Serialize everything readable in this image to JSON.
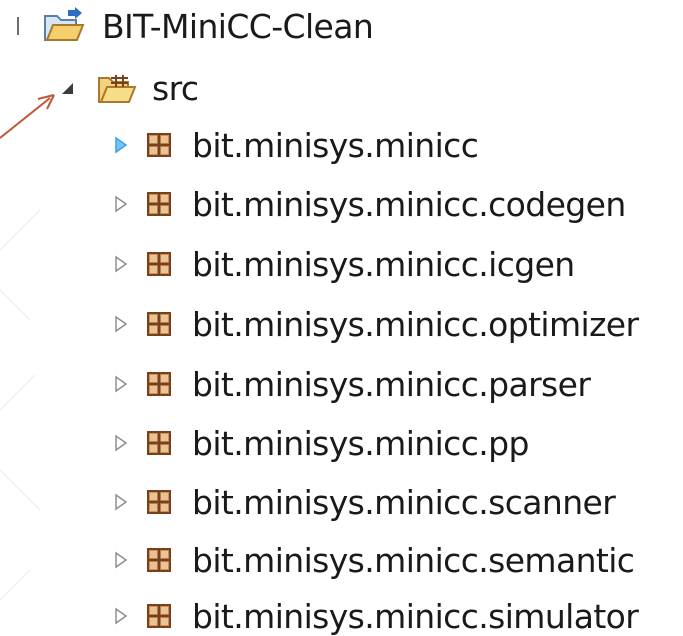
{
  "tree": {
    "project": {
      "label": "BIT-MiniCC-Clean",
      "icon": "project-folder-icon",
      "expanded": true
    },
    "source_folder": {
      "label": "src",
      "icon": "source-folder-icon",
      "expanded": true
    },
    "packages": [
      {
        "label": "bit.minisys.minicc",
        "icon": "package-icon",
        "expanded": false,
        "hovered": true
      },
      {
        "label": "bit.minisys.minicc.codegen",
        "icon": "package-icon",
        "expanded": false
      },
      {
        "label": "bit.minisys.minicc.icgen",
        "icon": "package-icon",
        "expanded": false
      },
      {
        "label": "bit.minisys.minicc.optimizer",
        "icon": "package-icon",
        "expanded": false
      },
      {
        "label": "bit.minisys.minicc.parser",
        "icon": "package-icon",
        "expanded": false
      },
      {
        "label": "bit.minisys.minicc.pp",
        "icon": "package-icon",
        "expanded": false
      },
      {
        "label": "bit.minisys.minicc.scanner",
        "icon": "package-icon",
        "expanded": false
      },
      {
        "label": "bit.minisys.minicc.semantic",
        "icon": "package-icon",
        "expanded": false
      },
      {
        "label": "bit.minisys.minicc.simulator",
        "icon": "package-icon",
        "expanded": false
      }
    ]
  },
  "colors": {
    "annotation_arrow": "#c0563a",
    "toggle_hover": "#3aa0e8",
    "toggle_normal": "#8f8f8f",
    "package_fill": "#c9935a",
    "package_line": "#7a3f1c",
    "folder_fill": "#f5cf6e"
  }
}
